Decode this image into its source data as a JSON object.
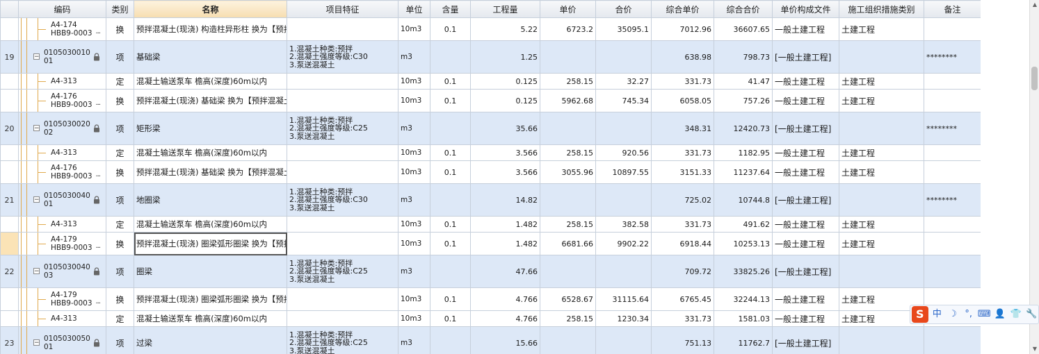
{
  "columns": {
    "idx": "",
    "code": "编码",
    "type": "类别",
    "name": "名称",
    "feature": "项目特征",
    "unit": "单位",
    "content": "含量",
    "quantity": "工程量",
    "unit_price": "单价",
    "total": "合价",
    "comp_unit_price": "综合单价",
    "comp_total": "综合合价",
    "price_file": "单价构成文件",
    "measure_type": "施工组织措施类别",
    "remark": "备注"
  },
  "rows": [
    {
      "kind": "sub",
      "idx": "",
      "code": "A4-174\nHBB9-0003",
      "more": "···",
      "type": "换",
      "name": "预拌混凝土(现浇) 构造柱异形柱  换为【预拌混凝土 C25】",
      "feature": "",
      "unit": "10m3",
      "content": "0.1",
      "quantity": "5.22",
      "unit_price": "6723.2",
      "total": "35095.1",
      "comp_unit_price": "7012.96",
      "comp_total": "36607.65",
      "price_file": "一般土建工程",
      "measure_type": "土建工程",
      "remark": ""
    },
    {
      "kind": "item",
      "idx": "19",
      "code": "0105030010\n01",
      "type": "项",
      "name": "基础梁",
      "feature": "1.混凝土种类:预拌\n2.混凝土强度等级:C30\n3.泵送混凝土",
      "unit": "m3",
      "content": "",
      "quantity": "1.25",
      "unit_price": "",
      "total": "",
      "comp_unit_price": "638.98",
      "comp_total": "798.73",
      "price_file": "[一般土建工程]",
      "measure_type": "",
      "remark": "********"
    },
    {
      "kind": "sub",
      "idx": "",
      "code": "A4-313",
      "more": "",
      "type": "定",
      "name": "混凝土输送泵车 檐高(深度)60m以内",
      "feature": "",
      "unit": "10m3",
      "content": "0.1",
      "quantity": "0.125",
      "unit_price": "258.15",
      "total": "32.27",
      "comp_unit_price": "331.73",
      "comp_total": "41.47",
      "price_file": "一般土建工程",
      "measure_type": "土建工程",
      "remark": ""
    },
    {
      "kind": "sub",
      "idx": "",
      "code": "A4-176\nHBB9-0003",
      "more": "···",
      "type": "换",
      "name": "预拌混凝土(现浇) 基础梁  换为【预拌混凝土 C30】",
      "feature": "",
      "unit": "10m3",
      "content": "0.1",
      "quantity": "0.125",
      "unit_price": "5962.68",
      "total": "745.34",
      "comp_unit_price": "6058.05",
      "comp_total": "757.26",
      "price_file": "一般土建工程",
      "measure_type": "土建工程",
      "remark": ""
    },
    {
      "kind": "item",
      "idx": "20",
      "code": "0105030020\n02",
      "type": "项",
      "name": "矩形梁",
      "feature": "1.混凝土种类:预拌\n2.混凝土强度等级:C25\n3.泵送混凝土",
      "unit": "m3",
      "content": "",
      "quantity": "35.66",
      "unit_price": "",
      "total": "",
      "comp_unit_price": "348.31",
      "comp_total": "12420.73",
      "price_file": "[一般土建工程]",
      "measure_type": "",
      "remark": "********"
    },
    {
      "kind": "sub",
      "idx": "",
      "code": "A4-313",
      "more": "",
      "type": "定",
      "name": "混凝土输送泵车 檐高(深度)60m以内",
      "feature": "",
      "unit": "10m3",
      "content": "0.1",
      "quantity": "3.566",
      "unit_price": "258.15",
      "total": "920.56",
      "comp_unit_price": "331.73",
      "comp_total": "1182.95",
      "price_file": "一般土建工程",
      "measure_type": "土建工程",
      "remark": ""
    },
    {
      "kind": "sub",
      "idx": "",
      "code": "A4-176\nHBB9-0003",
      "more": "···",
      "type": "换",
      "name": "预拌混凝土(现浇) 基础梁  换为【预拌混凝土 C25】",
      "feature": "",
      "unit": "10m3",
      "content": "0.1",
      "quantity": "3.566",
      "unit_price": "3055.96",
      "total": "10897.55",
      "comp_unit_price": "3151.33",
      "comp_total": "11237.64",
      "price_file": "一般土建工程",
      "measure_type": "土建工程",
      "remark": ""
    },
    {
      "kind": "item",
      "idx": "21",
      "code": "0105030040\n01",
      "type": "项",
      "name": "地圈梁",
      "feature": "1.混凝土种类:预拌\n2.混凝土强度等级:C30\n3.泵送混凝土",
      "unit": "m3",
      "content": "",
      "quantity": "14.82",
      "unit_price": "",
      "total": "",
      "comp_unit_price": "725.02",
      "comp_total": "10744.8",
      "price_file": "[一般土建工程]",
      "measure_type": "",
      "remark": "********"
    },
    {
      "kind": "sub",
      "idx": "",
      "code": "A4-313",
      "more": "",
      "type": "定",
      "name": "混凝土输送泵车 檐高(深度)60m以内",
      "feature": "",
      "unit": "10m3",
      "content": "0.1",
      "quantity": "1.482",
      "unit_price": "258.15",
      "total": "382.58",
      "comp_unit_price": "331.73",
      "comp_total": "491.62",
      "price_file": "一般土建工程",
      "measure_type": "土建工程",
      "remark": ""
    },
    {
      "kind": "sub",
      "idx": "",
      "code": "A4-179\nHBB9-0003",
      "more": "···",
      "type": "换",
      "name": "预拌混凝土(现浇) 圈梁弧形圈梁  换为【预拌混凝土 C30】",
      "feature": "",
      "unit": "10m3",
      "content": "0.1",
      "quantity": "1.482",
      "unit_price": "6681.66",
      "total": "9902.22",
      "comp_unit_price": "6918.44",
      "comp_total": "10253.13",
      "price_file": "一般土建工程",
      "measure_type": "土建工程",
      "remark": "",
      "current": true
    },
    {
      "kind": "item",
      "idx": "22",
      "code": "0105030040\n03",
      "type": "项",
      "name": "圈梁",
      "feature": "1.混凝土种类:预拌\n2.混凝土强度等级:C25\n3.泵送混凝土",
      "unit": "m3",
      "content": "",
      "quantity": "47.66",
      "unit_price": "",
      "total": "",
      "comp_unit_price": "709.72",
      "comp_total": "33825.26",
      "price_file": "[一般土建工程]",
      "measure_type": "",
      "remark": ""
    },
    {
      "kind": "sub",
      "idx": "",
      "code": "A4-179\nHBB9-0003",
      "more": "···",
      "type": "换",
      "name": "预拌混凝土(现浇) 圈梁弧形圈梁  换为【预拌混凝土 C25】",
      "feature": "",
      "unit": "10m3",
      "content": "0.1",
      "quantity": "4.766",
      "unit_price": "6528.67",
      "total": "31115.64",
      "comp_unit_price": "6765.45",
      "comp_total": "32244.13",
      "price_file": "一般土建工程",
      "measure_type": "土建工程",
      "remark": ""
    },
    {
      "kind": "sub",
      "idx": "",
      "code": "A4-313",
      "more": "",
      "type": "定",
      "name": "混凝土输送泵车 檐高(深度)60m以内",
      "feature": "",
      "unit": "10m3",
      "content": "0.1",
      "quantity": "4.766",
      "unit_price": "258.15",
      "total": "1230.34",
      "comp_unit_price": "331.73",
      "comp_total": "1581.03",
      "price_file": "一般土建工程",
      "measure_type": "土建工程",
      "remark": ""
    },
    {
      "kind": "item",
      "idx": "23",
      "code": "0105030050\n01",
      "type": "项",
      "name": "过梁",
      "feature": "1.混凝土种类:预拌\n2.混凝土强度等级:C25\n3.泵送混凝土",
      "unit": "m3",
      "content": "",
      "quantity": "15.66",
      "unit_price": "",
      "total": "",
      "comp_unit_price": "751.13",
      "comp_total": "11762.7",
      "price_file": "[一般土建工程]",
      "measure_type": "",
      "remark": ""
    }
  ],
  "ime_toolbar": {
    "logo": "S",
    "items": [
      {
        "name": "chinese-mode",
        "glyph": "中"
      },
      {
        "name": "moon-icon",
        "glyph": "☽"
      },
      {
        "name": "punctuation-icon",
        "glyph": "°,"
      },
      {
        "name": "keyboard-icon",
        "glyph": "⌨"
      },
      {
        "name": "user-icon",
        "glyph": "👤"
      },
      {
        "name": "shirt-icon",
        "glyph": "👕"
      },
      {
        "name": "wrench-icon",
        "glyph": "🔧"
      }
    ]
  },
  "colors": {
    "item_row": "#dde8f7",
    "tree_line": "#e0a94c",
    "header_sorted": "#f6ddb0",
    "current_row_index": "#fbe3b6"
  }
}
